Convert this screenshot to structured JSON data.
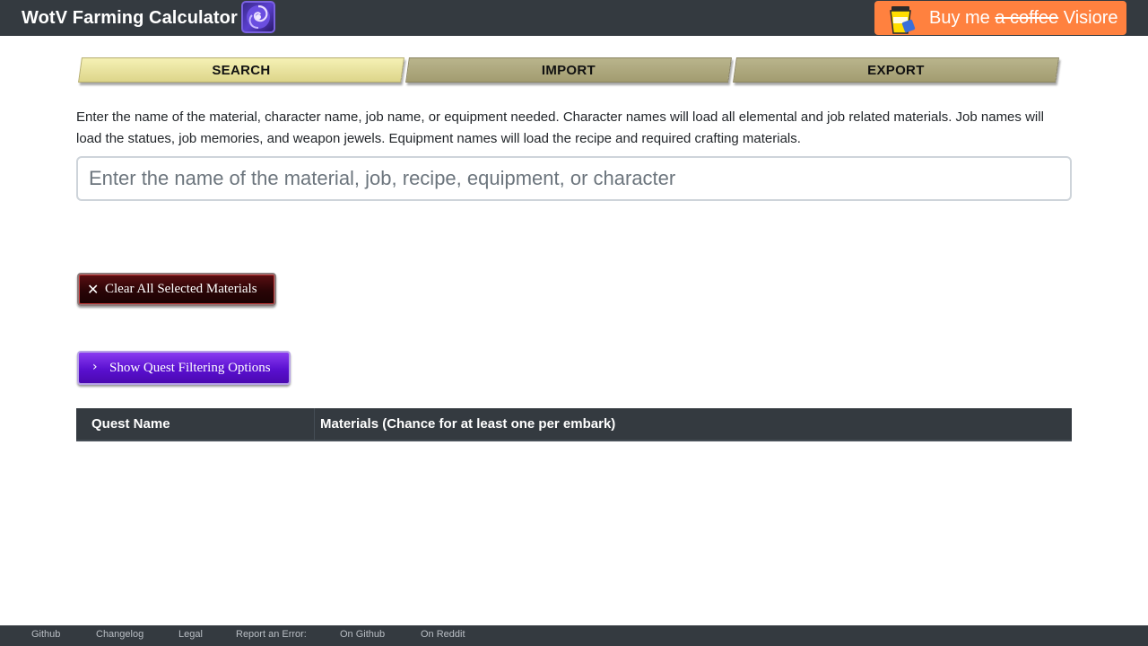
{
  "navbar": {
    "brand": "WotV Farming Calculator",
    "coffee": {
      "prefix": "Buy me ",
      "struck": "a coffee",
      "suffix": " Visiore"
    }
  },
  "tabs": [
    {
      "label": "SEARCH",
      "active": true
    },
    {
      "label": "IMPORT",
      "active": false
    },
    {
      "label": "EXPORT",
      "active": false
    }
  ],
  "search": {
    "description": "Enter the name of the material, character name, job name, or equipment needed. Character names will load all elemental and job related materials. Job names will load the statues, job memories, and weapon jewels. Equipment names will load the recipe and required crafting materials.",
    "placeholder": "Enter the name of the material, job, recipe, equipment, or character",
    "value": ""
  },
  "buttons": {
    "clear_icon": "✕",
    "clear_label": "Clear All Selected Materials",
    "filter_icon": "›",
    "filter_label": "Show Quest Filtering Options"
  },
  "table": {
    "headers": [
      "Quest Name",
      "Materials (Chance for at least one per embark)"
    ],
    "rows": []
  },
  "footer": {
    "links": [
      "Github",
      "Changelog",
      "Legal",
      "Report an Error:",
      "On Github",
      "On Reddit"
    ]
  },
  "colors": {
    "navbar": "#343a40",
    "coffee": "#ff813f",
    "tab_active": "#ece69c",
    "tab_inactive": "#aea879",
    "clear_button": "#2a0406",
    "filter_button": "#5a10d0"
  }
}
